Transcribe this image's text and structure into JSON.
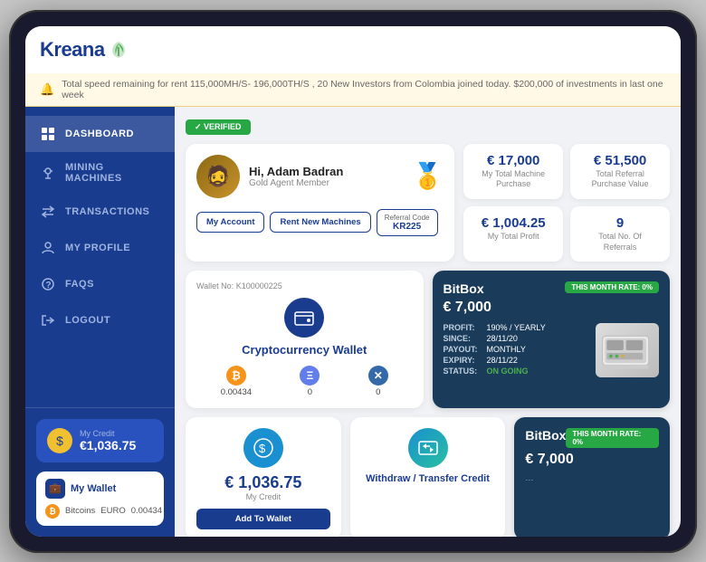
{
  "app": {
    "title": "Kreana",
    "verified_label": "✓ VERIFIED"
  },
  "notification": {
    "text": "Total speed remaining for rent 115,000MH/S- 196,000TH/S , 20 New Investors from Colombia joined today. $200,000 of investments in last one week"
  },
  "sidebar": {
    "items": [
      {
        "id": "dashboard",
        "label": "DASHBOARD",
        "active": true
      },
      {
        "id": "mining",
        "label": "MINING MACHINES",
        "active": false
      },
      {
        "id": "transactions",
        "label": "TRANSACTIONS",
        "active": false
      },
      {
        "id": "profile",
        "label": "MY PROFILE",
        "active": false
      },
      {
        "id": "faqs",
        "label": "FAQS",
        "active": false
      },
      {
        "id": "logout",
        "label": "LOGOUT",
        "active": false
      }
    ],
    "my_credit": {
      "label": "My Credit",
      "amount": "€1,036.75"
    },
    "my_wallet": {
      "title": "My Wallet",
      "crypto_label": "Bitcoins",
      "crypto_currency": "EURO",
      "crypto_amount": "0.00434"
    }
  },
  "profile": {
    "greeting": "Hi, Adam Badran",
    "member_type": "Gold Agent Member",
    "buttons": {
      "my_account": "My Account",
      "rent_machines": "Rent New Machines",
      "referral_code_label": "Referral Code",
      "referral_code": "KR225"
    }
  },
  "stats": [
    {
      "value": "€ 17,000",
      "label": "My Total Machine Purchase"
    },
    {
      "value": "€ 51,500",
      "label": "Total Referral Purchase Value"
    },
    {
      "value": "€ 1,004.25",
      "label": "My Total Profit"
    },
    {
      "value": "9",
      "label": "Total No. Of Referrals"
    }
  ],
  "wallet": {
    "wallet_no_label": "Wallet No:",
    "wallet_no": "K100000225",
    "title": "Cryptocurrency Wallet",
    "cryptos": [
      {
        "symbol": "₿",
        "value": "0.00434",
        "color": "#f7931a"
      },
      {
        "symbol": "Ξ",
        "value": "0",
        "color": "#627eea"
      },
      {
        "symbol": "✕",
        "value": "0",
        "color": "#346aa9"
      }
    ]
  },
  "bitbox1": {
    "name": "BitBox",
    "price": "€ 7,000",
    "rate_label": "THIS MONTH RATE: 0%",
    "details": {
      "profit_label": "PROFIT:",
      "profit_val": "190% / YEARLY",
      "since_label": "SINCE:",
      "since_val": "28/11/20",
      "payout_label": "PAYOUT:",
      "payout_val": "MONTHLY",
      "expiry_label": "EXPIRY:",
      "expiry_val": "28/11/22",
      "status_label": "STATUS:",
      "status_val": "ON GOING"
    }
  },
  "bitbox2": {
    "name": "BitBox",
    "price": "€ 7,000",
    "rate_label": "THIS MONTH RATE: 0%"
  },
  "credit_card": {
    "amount": "€ 1,036.75",
    "label": "My Credit",
    "button": "Add To Wallet"
  },
  "transfer_card": {
    "label": "Withdraw / Transfer Credit"
  }
}
